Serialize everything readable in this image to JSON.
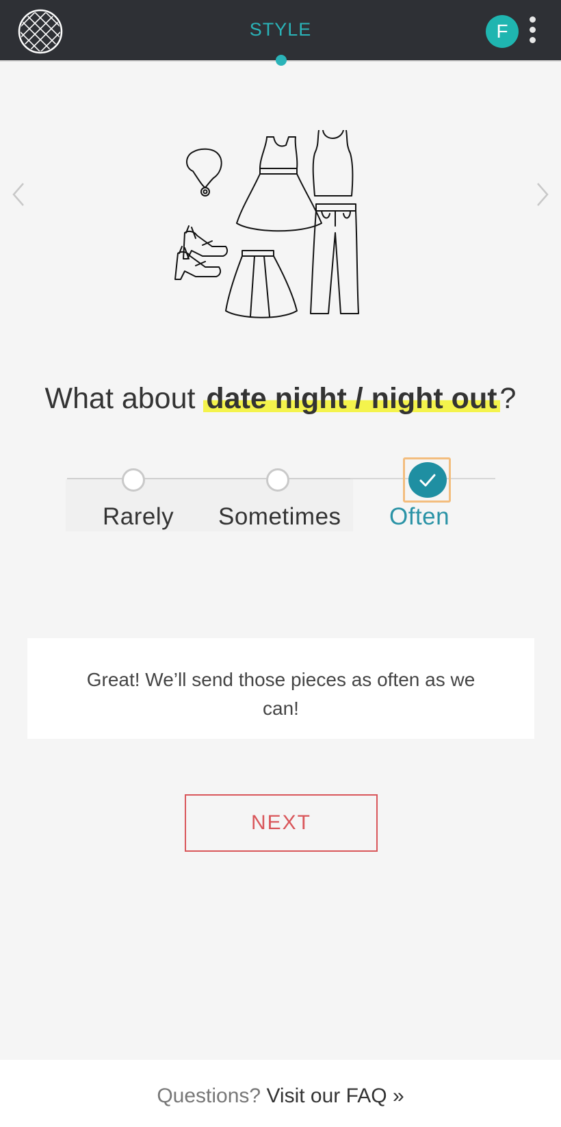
{
  "header": {
    "logo_icon": "stitch-lattice-logo-icon",
    "title": "STYLE",
    "avatar_initial": "F",
    "menu_icon": "kebab-menu-icon",
    "accent_color": "#2ab3b8"
  },
  "carousel": {
    "prev_icon": "chevron-left-icon",
    "next_icon": "chevron-right-icon",
    "illustration": "clothing-outfit-illustration"
  },
  "question": {
    "prefix": "What about ",
    "highlight": "date night / night out",
    "suffix": "?"
  },
  "frequency": {
    "options": [
      {
        "label": "Rarely",
        "selected": false
      },
      {
        "label": "Sometimes",
        "selected": false
      },
      {
        "label": "Often",
        "selected": true
      }
    ],
    "check_icon": "check-icon",
    "selected_color": "#1f8fa2"
  },
  "message": {
    "text": "Great! We’ll send those pieces as often as we can!"
  },
  "next_button": {
    "label": "NEXT",
    "color": "#d9565a"
  },
  "footer": {
    "question": "Questions? ",
    "link_text": "Visit our FAQ »"
  }
}
